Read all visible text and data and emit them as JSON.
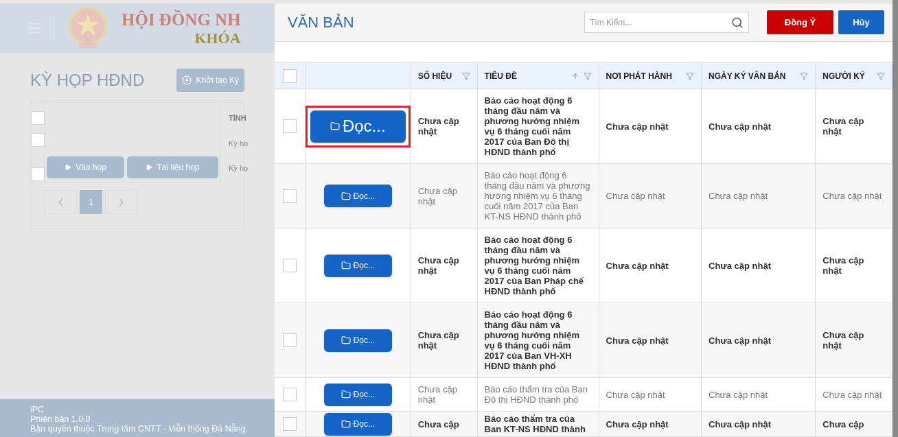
{
  "background_page": {
    "header": {
      "title_line_1": "HỘI ĐỒNG NH",
      "title_line_2": "KHÓA"
    },
    "heading": "KỲ HỌP HĐND",
    "create_button": "Khởi tạo Kỳ",
    "table": {
      "header_checked": false,
      "column_3": "TÍNH",
      "rows": [
        {
          "checked": false,
          "buttons": [],
          "column_3": "Kỳ họ"
        },
        {
          "checked": false,
          "buttons": [
            "Vào họp",
            "Tài liệu họp"
          ],
          "column_3": "Kỳ họ"
        }
      ]
    },
    "pagination": [
      {
        "label": "1",
        "selected": true
      }
    ],
    "footer": [
      "iPC",
      "Phiên bản 1.0.0",
      "Bản quyền thuộc Trung tâm CNTT - Viễn thông Đà Nẵng."
    ]
  },
  "dialog": {
    "title": "VĂN BẢN",
    "search": {
      "placeholder": "Tìm Kiếm..."
    },
    "buttons": [
      {
        "label": "Đồng Ý",
        "kind": "confirm"
      },
      {
        "label": "Hủy",
        "kind": "cancel"
      }
    ],
    "table": {
      "header_checked": false,
      "columns": [
        {
          "label": "SỐ HIỆU",
          "sorted": false
        },
        {
          "label": "TIÊU ĐỀ",
          "sorted": true
        },
        {
          "label": "NƠI PHÁT HÀNH",
          "sorted": false
        },
        {
          "label": "NGÀY KÝ VĂN BẢN",
          "sorted": false
        },
        {
          "label": "NGƯỜI KÝ",
          "sorted": false
        }
      ],
      "rows": [
        {
          "checked": false,
          "unread": true,
          "highlighted": true,
          "button": "Đọc...",
          "so_hieu": "Chưa cập nhật",
          "tieu_de": "Báo cáo hoạt động 6 tháng đầu năm và phương hướng nhiệm vụ 6 tháng cuối năm 2017 của Ban Đô thị HĐND thành phố",
          "noi_phat_hanh": "Chưa cập nhật",
          "ngay_ky": "Chưa cập nhật",
          "nguoi_ky": "Chưa cập nhật"
        },
        {
          "checked": false,
          "unread": false,
          "highlighted": false,
          "button": "Đọc...",
          "so_hieu": "Chưa cập nhật",
          "tieu_de": "Báo cáo hoạt động 6 tháng đầu năm và phương hướng nhiệm vụ 6 tháng cuối năm 2017 của Ban KT-NS HĐND thành phố",
          "noi_phat_hanh": "Chưa cập nhật",
          "ngay_ky": "Chưa cập nhật",
          "nguoi_ky": "Chưa cập nhật"
        },
        {
          "checked": false,
          "unread": true,
          "highlighted": false,
          "button": "Đọc...",
          "so_hieu": "Chưa cập nhật",
          "tieu_de": "Báo cáo hoạt động 6 tháng đầu năm và phương hướng nhiệm vụ 6 tháng cuối năm 2017 của Ban Pháp chế HĐND thành phố",
          "noi_phat_hanh": "Chưa cập nhật",
          "ngay_ky": "Chưa cập nhật",
          "nguoi_ky": "Chưa cập nhật"
        },
        {
          "checked": false,
          "unread": true,
          "highlighted": false,
          "button": "Đọc...",
          "so_hieu": "Chưa cập nhật",
          "tieu_de": "Báo cáo hoạt động 6 tháng đầu năm và phương hướng nhiệm vụ 6 tháng cuối năm 2017 của Ban VH-XH HĐND thành phố",
          "noi_phat_hanh": "Chưa cập nhật",
          "ngay_ky": "Chưa cập nhật",
          "nguoi_ky": "Chưa cập nhật"
        },
        {
          "checked": false,
          "unread": false,
          "highlighted": false,
          "button": "Đọc...",
          "so_hieu": "Chưa cập nhật",
          "tieu_de": "Báo cáo thẩm tra của Ban Đô thị HĐND thành phố",
          "noi_phat_hanh": "Chưa cập nhật",
          "ngay_ky": "Chưa cập nhật",
          "nguoi_ky": "Chưa cập nhật"
        },
        {
          "checked": false,
          "unread": true,
          "highlighted": false,
          "button": "Đọc...",
          "so_hieu": "Chưa cập",
          "tieu_de": "Báo cáo thẩm tra của Ban KT-NS HĐND thành",
          "noi_phat_hanh": "Chưa cập nhật",
          "ngay_ky": "Chưa cập nhật",
          "nguoi_ky": "Chưa cập"
        }
      ]
    }
  }
}
